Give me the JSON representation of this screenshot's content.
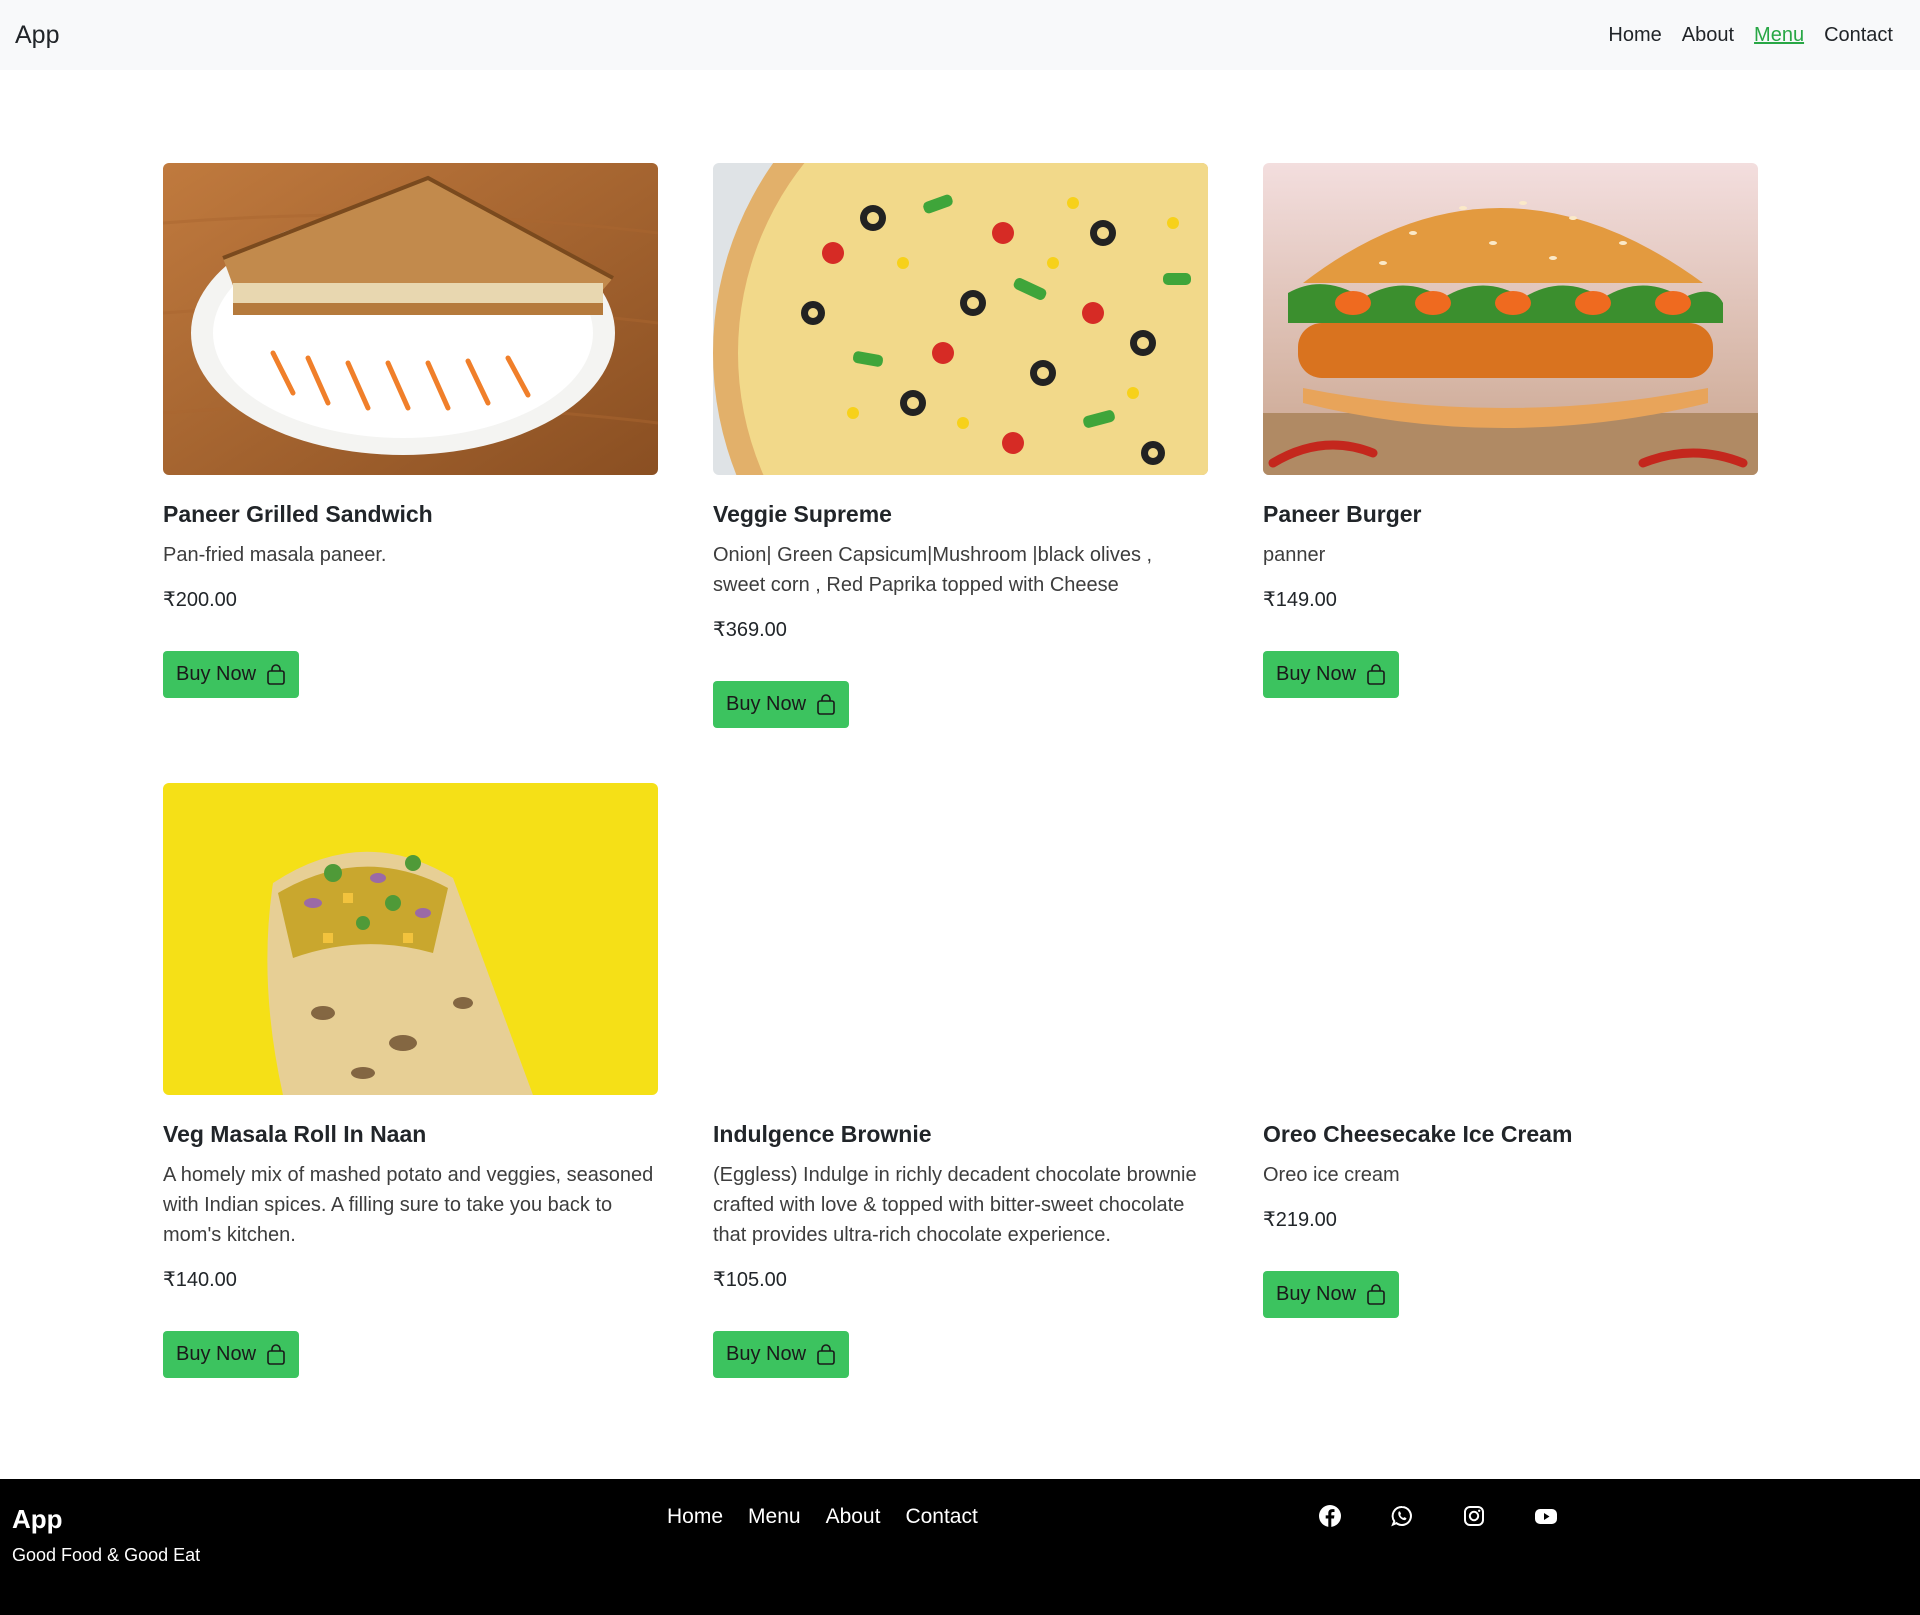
{
  "navbar": {
    "brand": "App",
    "links": [
      {
        "label": "Home"
      },
      {
        "label": "About"
      },
      {
        "label": "Menu",
        "active": true
      },
      {
        "label": "Contact"
      }
    ],
    "active_color": "#28a745"
  },
  "menu": {
    "items": [
      {
        "name": "Paneer Grilled Sandwich",
        "description": "Pan-fried masala paneer.",
        "price": "₹200.00",
        "button": "Buy Now",
        "image": "sandwich-on-plate"
      },
      {
        "name": "Veggie Supreme",
        "description": "Onion| Green Capsicum|Mushroom |black olives , sweet corn , Red Paprika topped with Cheese",
        "price": "₹369.00",
        "button": "Buy Now",
        "image": "vegetable-pizza"
      },
      {
        "name": "Paneer Burger",
        "description": "panner",
        "price": "₹149.00",
        "button": "Buy Now",
        "image": "paneer-burger"
      },
      {
        "name": "Veg Masala Roll In Naan",
        "description": "A homely mix of mashed potato and veggies, seasoned with Indian spices. A filling sure to take you back to mom's kitchen.",
        "price": "₹140.00",
        "button": "Buy Now",
        "image": "naan-roll-yellow-bg"
      },
      {
        "name": "Indulgence Brownie",
        "description": "(Eggless) Indulge in richly decadent chocolate brownie crafted with love & topped with bitter-sweet chocolate that provides ultra-rich chocolate experience.",
        "price": "₹105.00",
        "button": "Buy Now",
        "image": "none"
      },
      {
        "name": "Oreo Cheesecake Ice Cream",
        "description": "Oreo ice cream",
        "price": "₹219.00",
        "button": "Buy Now",
        "image": "none"
      }
    ],
    "button_color": "#3cc35f"
  },
  "footer": {
    "brand": "App",
    "tagline": "Good Food & Good Eat",
    "links": [
      {
        "label": "Home"
      },
      {
        "label": "Menu"
      },
      {
        "label": "About"
      },
      {
        "label": "Contact"
      }
    ],
    "socials": [
      "facebook-icon",
      "whatsapp-icon",
      "instagram-icon",
      "youtube-icon"
    ]
  }
}
